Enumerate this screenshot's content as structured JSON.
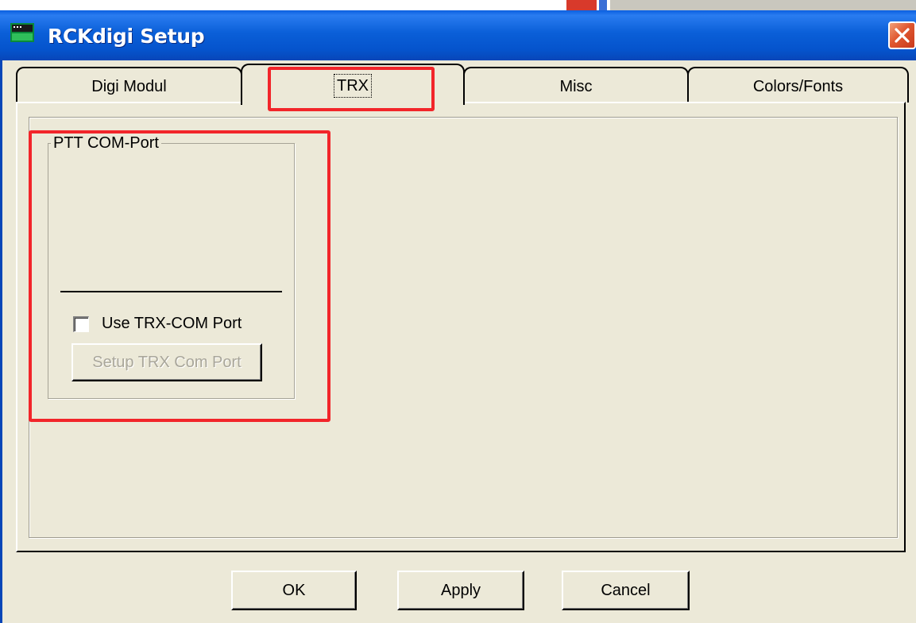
{
  "window": {
    "title": "RCKdigi Setup",
    "close_glyph": "✕"
  },
  "tabs": [
    {
      "label": "Digi Modul",
      "active": false
    },
    {
      "label": "TRX",
      "active": true
    },
    {
      "label": "Misc",
      "active": false
    },
    {
      "label": "Colors/Fonts",
      "active": false
    }
  ],
  "trx": {
    "group_title": "PTT COM-Port",
    "use_trx_com_label": "Use TRX-COM Port",
    "use_trx_com_checked": false,
    "setup_button_label": "Setup TRX Com Port",
    "setup_button_enabled": false
  },
  "buttons": {
    "ok": "OK",
    "apply": "Apply",
    "cancel": "Cancel"
  },
  "colors": {
    "titlebar": "#0a5fd8",
    "dialog_bg": "#ece9d8",
    "highlight": "#f2252a",
    "close_button": "#e0572f"
  },
  "icons": {
    "app": "app-icon",
    "close": "close-icon"
  }
}
